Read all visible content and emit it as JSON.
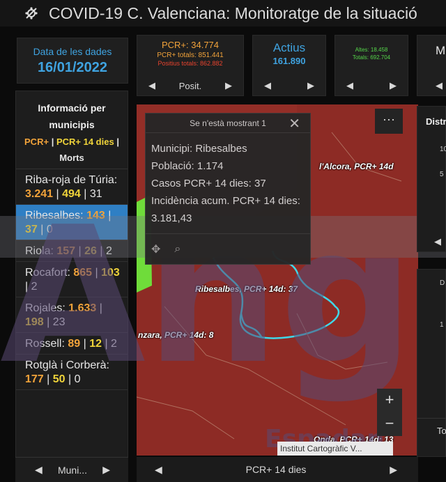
{
  "header": {
    "title": "COVID-19 C. Valenciana: Monitoratge de la situació",
    "logo_icon": "virus-logo-icon"
  },
  "date_panel": {
    "label": "Data de les dades",
    "value": "16/01/2022"
  },
  "pcr_panel": {
    "main": "PCR+: 34.774",
    "total": "PCR+ totals: 851.441",
    "positive_total": "Positius totals: 862.882",
    "pager_label": "Posit."
  },
  "actius_panel": {
    "label": "Actius",
    "value": "161.890"
  },
  "altes_panel": {
    "altes": "Altes: 18.458",
    "totals": "Totals: 692.704"
  },
  "m_panel": {
    "letter": "M"
  },
  "list": {
    "title_line1": "Informació per",
    "title_line2": "municipis",
    "legend_pcr": "PCR+",
    "legend_pcr14": "PCR+ 14 dies",
    "legend_sep": "|",
    "legend_morts": "Morts",
    "pager_label": "Muni...",
    "items": [
      {
        "name": "Riba-roja de Túria:",
        "v1": "3.241",
        "v2": "494",
        "v3": "31"
      },
      {
        "name": "Ribesalbes:",
        "v1": "143",
        "v2": "37",
        "v3": "0"
      },
      {
        "name": "Riola:",
        "v1": "157",
        "v2": "26",
        "v3": "2"
      },
      {
        "name": "Rocafort:",
        "v1": "865",
        "v2": "103",
        "v3": "2"
      },
      {
        "name": "Rojales:",
        "v1": "1.633",
        "v2": "198",
        "v3": "23"
      },
      {
        "name": "Rossell:",
        "v1": "89",
        "v2": "12",
        "v3": "2"
      },
      {
        "name": "Rotglà i Corberà:",
        "v1": "177",
        "v2": "50",
        "v3": "0"
      }
    ]
  },
  "popup": {
    "header": "Se n'està mostrant 1",
    "municipi": "Municipi: Ribesalbes",
    "poblacio": "Població: 1.174",
    "casos": "Casos PCR+ 14 dies: 37",
    "incidencia": "Incidència acum. PCR+ 14 dies: 3.181,43"
  },
  "map": {
    "labels": {
      "alcora": "l'Alcora, PCR+ 14d",
      "ribesalbes": "Ribesalbes, PCR+ 14d: 37",
      "fanzara": "nzara, PCR+ 14d: 8",
      "onda": "Onda, PCR+ 14d: 13"
    },
    "attribution": "Institut Cartogràfic V...",
    "pager_label": "PCR+ 14 dies",
    "zoom_in": "+",
    "zoom_out": "−",
    "more": "···"
  },
  "right_panel": {
    "title": "Distr",
    "ticks": [
      "10",
      "5"
    ],
    "lower_ticks": [
      "D",
      "1"
    ],
    "tab": "To"
  },
  "watermark": {
    "text": "Ang",
    "subtext": "Espadan"
  },
  "colors": {
    "accent_blue": "#3fa3e0",
    "pcr_orange": "#f2a33a",
    "pcr14_yellow": "#f0d43a",
    "positive_red": "#e8432e",
    "altes_green": "#55d64a",
    "selected_blue": "#2f7fc4"
  }
}
